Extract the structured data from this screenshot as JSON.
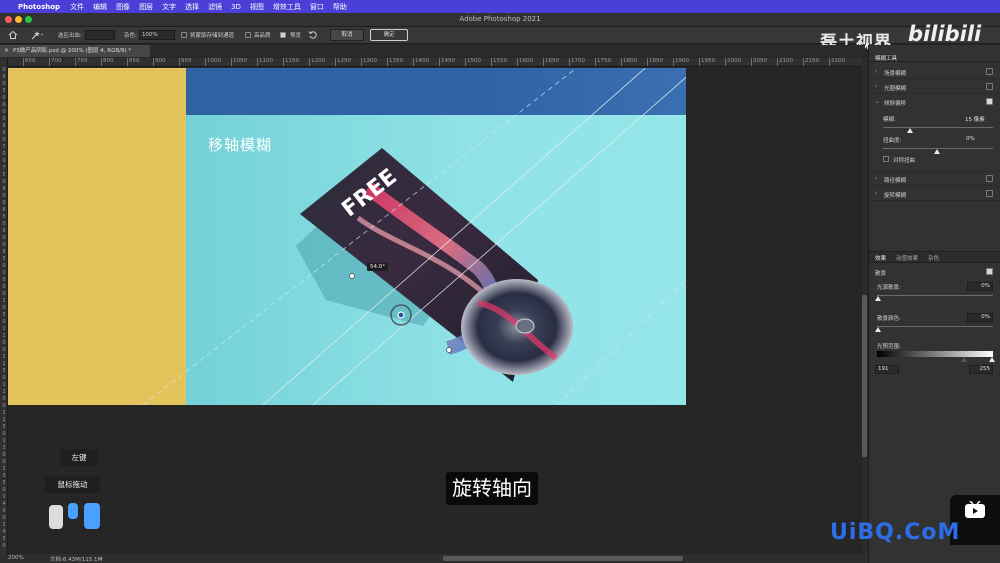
{
  "menubar": {
    "app_name": "Photoshop",
    "items": [
      "文件",
      "编辑",
      "图像",
      "图层",
      "文字",
      "选择",
      "滤镜",
      "3D",
      "视图",
      "增效工具",
      "窗口",
      "帮助"
    ]
  },
  "window": {
    "title": "Adobe Photoshop 2021"
  },
  "options_bar": {
    "selection_bleed_label": "选区出血:",
    "noise_label": "杂色:",
    "noise_value": "100%",
    "save_mask_label": "将蒙版存储到通道",
    "high_quality_label": "高品质",
    "preview_label": "预览",
    "cancel_label": "取消",
    "ok_label": "确定"
  },
  "watermark": {
    "channel_name": "磊土视界",
    "site_logo": "bilibili",
    "site_url": "UiBQ.CoM"
  },
  "document_tab": {
    "title": "PS做产品阴影.psd @ 200% (图层 4, RGB/8) *"
  },
  "ruler": {
    "horizontal": [
      "650",
      "700",
      "750",
      "800",
      "850",
      "900",
      "950",
      "1000",
      "1050",
      "1100",
      "1150",
      "1200",
      "1250",
      "1300",
      "1350",
      "1400",
      "1450",
      "1500",
      "1550",
      "1600",
      "1650",
      "1700",
      "1750",
      "1800",
      "1850",
      "1900",
      "1950",
      "2000",
      "2050",
      "2100",
      "2150",
      "2200"
    ],
    "vertical": [
      "0",
      "5",
      "0",
      "5",
      "0",
      "6",
      "0",
      "0",
      "6",
      "5",
      "0",
      "7",
      "0",
      "0",
      "7",
      "5",
      "0",
      "8",
      "0",
      "0",
      "8",
      "5",
      "0",
      "9",
      "0",
      "0",
      "9",
      "5",
      "0",
      "1",
      "0",
      "0",
      "0",
      "1",
      "0",
      "5",
      "0",
      "1",
      "1",
      "0",
      "0",
      "1",
      "1",
      "5",
      "0",
      "1",
      "2",
      "0",
      "0",
      "1",
      "2",
      "5",
      "0",
      "1",
      "3",
      "0",
      "0",
      "1",
      "3",
      "5",
      "0",
      "1",
      "4",
      "0",
      "0",
      "1",
      "4",
      "5",
      "0"
    ]
  },
  "canvas": {
    "title": "移轴模糊",
    "product_text": "FREE",
    "angle_readout": "54.0°",
    "colors": {
      "yellow": "#e3c35b",
      "teal": "#8fe2e6",
      "blue_band": "#2f62a3"
    }
  },
  "overlay": {
    "left_click_label": "左键",
    "mouse_drag_label": "鼠标拖动",
    "subtitle": "旋转轴向"
  },
  "status_bar": {
    "zoom": "200%",
    "doc_info": "文档:6.43M/115.1M"
  },
  "panel": {
    "header_tab": "模糊工具",
    "blur_rows": [
      {
        "label": "场景模糊",
        "checked": false
      },
      {
        "label": "光圈模糊",
        "checked": false
      },
      {
        "label": "倾斜偏移",
        "checked": true
      }
    ],
    "blur_label": "模糊:",
    "blur_value": "15 像素",
    "distortion_label": "扭曲度:",
    "distortion_value": "0%",
    "symmetric_label": "对称扭曲",
    "other_rows": [
      {
        "label": "路径模糊",
        "checked": false
      },
      {
        "label": "旋转模糊",
        "checked": false
      }
    ],
    "effects_tabs": [
      "效果",
      "动感效果",
      "杂色"
    ],
    "bokeh_label": "散景",
    "light_bokeh_label": "光源散景:",
    "light_bokeh_value": "0%",
    "bokeh_color_label": "散景颜色:",
    "bokeh_color_value": "0%",
    "light_range_label": "光照范围:",
    "light_range_low": "191",
    "light_range_high": "255"
  }
}
